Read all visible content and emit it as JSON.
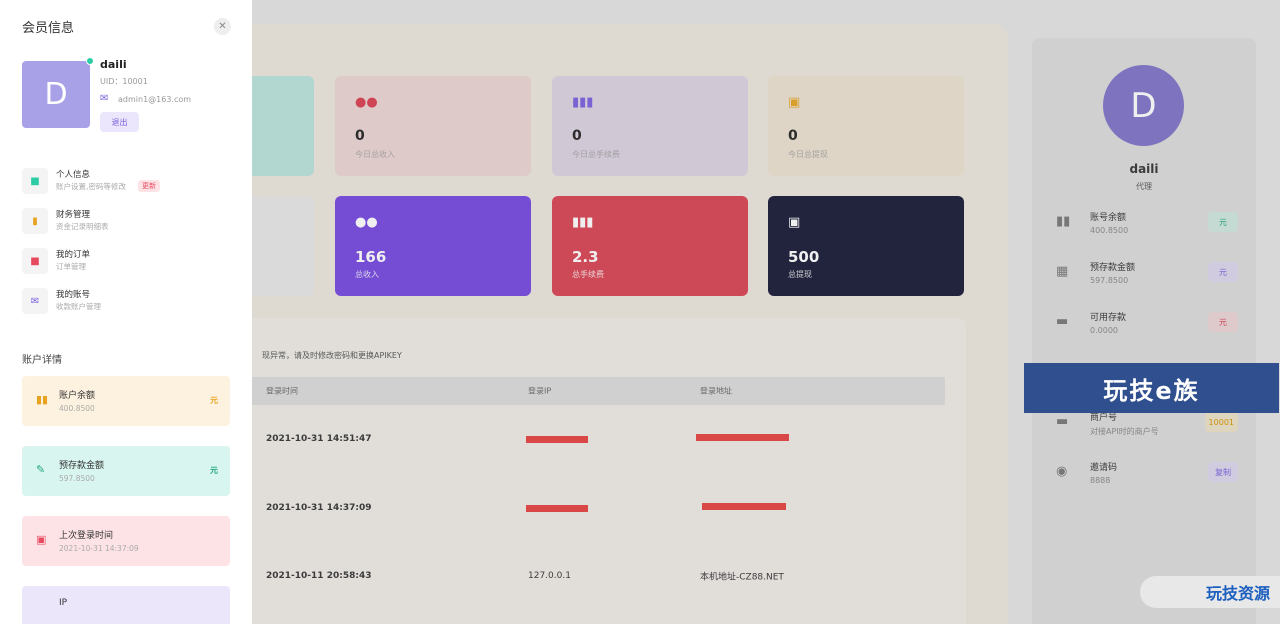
{
  "stat_cards_top": [
    {
      "icon": "users-icon",
      "value": "0",
      "label": "今日总收入",
      "bg": "#ecd6d4",
      "color": "#dc3e50"
    },
    {
      "icon": "bar-icon",
      "value": "0",
      "label": "今日总手续费",
      "bg": "#ddd3e3",
      "color": "#7b5fe0"
    },
    {
      "icon": "wallet-icon",
      "value": "0",
      "label": "今日总提现",
      "bg": "#ece2d1",
      "color": "#e8a320"
    }
  ],
  "stat_cards_bottom": [
    {
      "icon": "users-icon",
      "value": "166",
      "label": "总收入",
      "bg": "#7447e1"
    },
    {
      "icon": "bar-icon",
      "value": "2.3",
      "label": "总手续费",
      "bg": "#da4352"
    },
    {
      "icon": "wallet-icon",
      "value": "500",
      "label": "总提现",
      "bg": "#151834"
    }
  ],
  "login_log": {
    "tip": "现异常，请及时修改密码和更换APIKEY",
    "headers": [
      "登录时间",
      "登录IP",
      "登录地址"
    ],
    "rows": [
      {
        "time": "2021-10-31 14:51:47",
        "ip": "",
        "address": ""
      },
      {
        "time": "2021-10-31 14:37:09",
        "ip": "",
        "address": ""
      },
      {
        "time": "2021-10-11 20:58:43",
        "ip": "127.0.0.1",
        "address": "本机地址-CZ88.NET"
      }
    ]
  },
  "profile": {
    "avatar_letter": "D",
    "name": "daili",
    "role": "代理",
    "rows": [
      {
        "icon": "bar-icon",
        "label": "账号余额",
        "value": "400.8500",
        "badge": "元",
        "badge_bg": "#cfe8de",
        "badge_color": "#22a77f"
      },
      {
        "icon": "grid-icon",
        "label": "预存款金额",
        "value": "597.8500",
        "badge": "元",
        "badge_bg": "#ddd7ee",
        "badge_color": "#7b5fe0"
      },
      {
        "icon": "card-icon",
        "label": "可用存款",
        "value": "0.0000",
        "badge": "元",
        "badge_bg": "#ecd4d6",
        "badge_color": "#dc3e50"
      },
      {
        "icon": "card-icon",
        "label": "商户号",
        "value": "对接API时的商户号",
        "badge": "10001",
        "badge_bg": "#ece2c8",
        "badge_color": "#d69500"
      },
      {
        "icon": "globe-icon",
        "label": "邀请码",
        "value": "8888",
        "badge": "复制",
        "badge_bg": "#ddd7ee",
        "badge_color": "#7b5fe0"
      }
    ]
  },
  "watermark": {
    "banner": "玩技e族",
    "corner": "玩技资源"
  },
  "drawer": {
    "title": "会员信息",
    "close": "✕",
    "avatar_letter": "D",
    "name": "daili",
    "uid": "UID：10001",
    "email": "admin1@163.com",
    "logout": "退出",
    "menu": [
      {
        "icon": "file-icon",
        "label": "个人信息",
        "sub": "账户设置,密码等修改",
        "badge": "更新",
        "color": "#2ccca6"
      },
      {
        "icon": "chart-icon",
        "label": "财务管理",
        "sub": "资金记录明细表",
        "badge": "",
        "color": "#e8a320"
      },
      {
        "icon": "order-icon",
        "label": "我的订单",
        "sub": "订单管理",
        "badge": "",
        "color": "#e74a5f"
      },
      {
        "icon": "account-icon",
        "label": "我的账号",
        "sub": "收款账户管理",
        "badge": "",
        "color": "#7b5fe0"
      }
    ],
    "section_title": "账户详情",
    "accounts": [
      {
        "icon": "books-icon",
        "label": "账户余额",
        "value": "400.8500",
        "unit": "元",
        "bg": "#fdf2df",
        "color": "#e8a320"
      },
      {
        "icon": "edit-icon",
        "label": "预存款金额",
        "value": "597.8500",
        "unit": "元",
        "bg": "#d8f6ef",
        "color": "#22a77f"
      },
      {
        "icon": "clock-icon",
        "label": "上次登录时间",
        "value": "2021-10-31 14:37:09",
        "unit": "",
        "bg": "#fde3e6",
        "color": "#e74a5f"
      },
      {
        "icon": "ip-icon",
        "label": "IP",
        "value": "",
        "unit": "",
        "bg": "#ece6fb",
        "color": "#7b5fe0"
      }
    ]
  }
}
